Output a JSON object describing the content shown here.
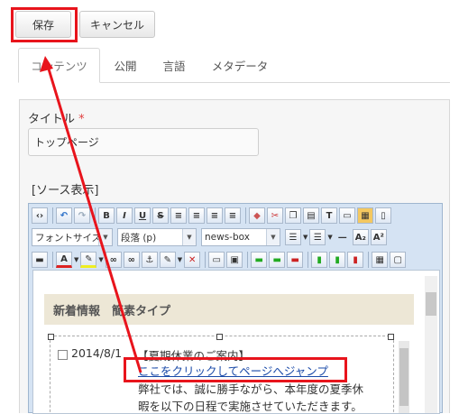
{
  "toolbar": {
    "save_label": "保存",
    "cancel_label": "キャンセル"
  },
  "tabs": [
    {
      "label": "コンテンツ",
      "active": true
    },
    {
      "label": "公開",
      "active": false
    },
    {
      "label": "言語",
      "active": false
    },
    {
      "label": "メタデータ",
      "active": false
    }
  ],
  "form": {
    "title_label": "タイトル",
    "required_mark": "*",
    "title_value": "トップページ",
    "source_toggle": "[ソース表示]"
  },
  "editor": {
    "font_size_combo": "フォントサイズ",
    "paragraph_combo": "段落 (p)",
    "style_combo": "news-box",
    "content": {
      "heading": "新着情報　簡素タイプ",
      "date": "2014/8/1",
      "news_title": "【夏期休業のご案内】",
      "link_text": "ここをクリックしてページへジャンプ",
      "body_line1": "弊社では、誠に勝手ながら、本年度の夏季休",
      "body_line2": "暇を以下の日程で実施させていただきます。"
    }
  },
  "annotation": {
    "arrow_color": "#e8141c",
    "highlight_color": "#e8141c"
  }
}
